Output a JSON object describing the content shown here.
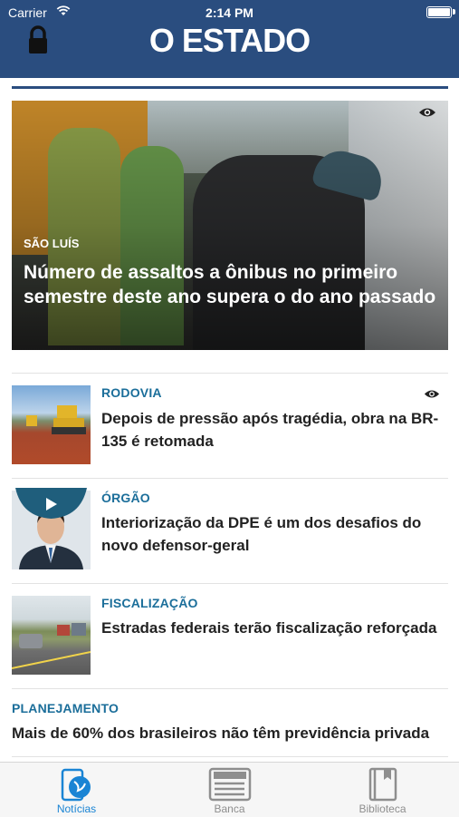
{
  "status_bar": {
    "carrier": "Carrier",
    "time": "2:14 PM"
  },
  "header": {
    "logo": "O ESTADO"
  },
  "hero": {
    "category": "SÃO LUÍS",
    "title": "Número de assaltos a ônibus no primeiro semestre deste ano supera o do ano passado"
  },
  "articles": [
    {
      "category": "RODOVIA",
      "title": "Depois de pressão após tragédia, obra na BR-135 é retomada"
    },
    {
      "category": "ÓRGÃO",
      "title": "Interiorização da DPE é um dos desafios do novo defensor-geral"
    },
    {
      "category": "FISCALIZAÇÃO",
      "title": "Estradas federais terão fiscalização reforçada"
    },
    {
      "category": "PLANEJAMENTO",
      "title": "Mais de 60% dos brasileiros não têm previdência privada"
    }
  ],
  "tabbar": {
    "tabs": [
      {
        "label": "Notícias",
        "active": true
      },
      {
        "label": "Banca",
        "active": false
      },
      {
        "label": "Biblioteca",
        "active": false
      }
    ]
  },
  "colors": {
    "brand": "#2a4d7f",
    "category": "#1b6e9a",
    "active_tab": "#1a84d4"
  }
}
